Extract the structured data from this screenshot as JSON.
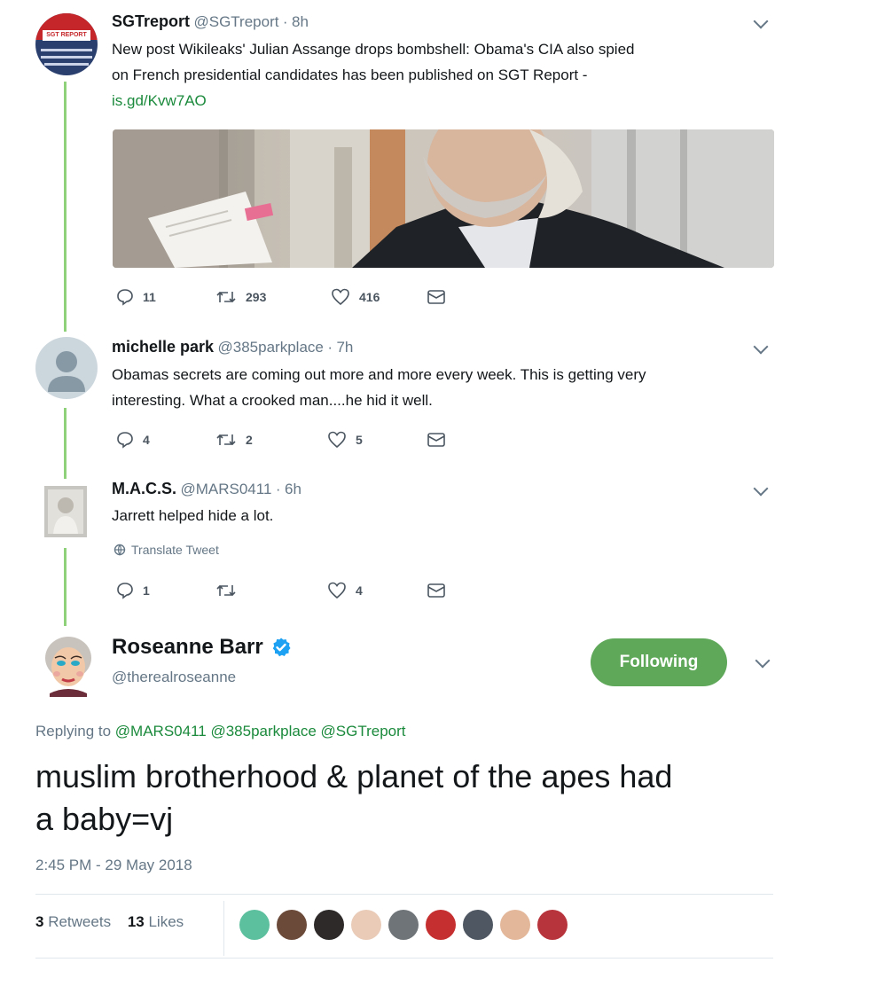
{
  "tweets": [
    {
      "name": "SGTreport",
      "handle": "@SGTreport",
      "time": "8h",
      "avatar_text": "SGT REPORT",
      "text_lines": [
        "New post Wikileaks' Julian Assange drops bombshell: Obama's CIA also spied",
        "on French presidential candidates has been published on SGT Report -"
      ],
      "link": "is.gd/Kvw7AO",
      "replies": "11",
      "retweets": "293",
      "likes": "416"
    },
    {
      "name": "michelle park",
      "handle": "@385parkplace",
      "time": "7h",
      "text_lines": [
        "Obamas secrets are coming out more and more every week. This is getting very",
        "interesting.  What a crooked man....he hid it well."
      ],
      "replies": "4",
      "retweets": "2",
      "likes": "5"
    },
    {
      "name": "M.A.C.S.",
      "handle": "@MARS0411",
      "time": "6h",
      "text_lines": [
        "Jarrett helped hide a lot."
      ],
      "translate": "Translate Tweet",
      "replies": "1",
      "retweets": "",
      "likes": "4"
    }
  ],
  "main": {
    "name": "Roseanne Barr",
    "handle": "@therealroseanne",
    "follow_label": "Following",
    "replying_to": "Replying to",
    "mentions": "@MARS0411 @385parkplace @SGTreport",
    "text_line1": "muslim brotherhood & planet of the apes had",
    "text_line2": "a baby=vj",
    "timestamp": "2:45 PM - 29 May 2018",
    "retweets_count": "3",
    "retweets_label": "Retweets",
    "likes_count": "13",
    "likes_label": "Likes"
  },
  "colors": {
    "follow_green": "#5fa85a",
    "thread_line": "#8fd07a",
    "verified_blue": "#1da1f2"
  }
}
